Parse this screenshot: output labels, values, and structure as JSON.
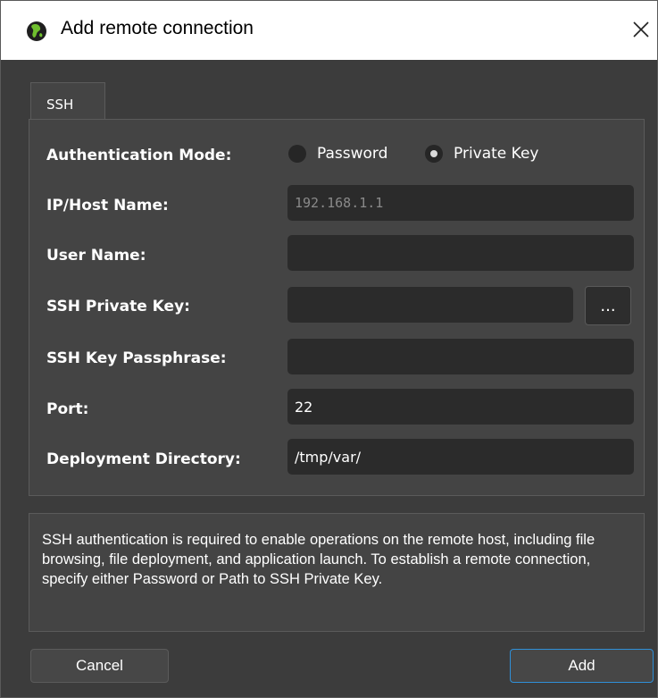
{
  "window": {
    "title": "Add remote connection"
  },
  "tabs": [
    {
      "label": "SSH"
    }
  ],
  "form": {
    "auth_mode_label": "Authentication Mode:",
    "auth_options": [
      {
        "label": "Password",
        "checked": false
      },
      {
        "label": "Private Key",
        "checked": true
      }
    ],
    "host_label": "IP/Host Name:",
    "host_placeholder": "192.168.1.1",
    "host_value": "",
    "user_label": "User Name:",
    "user_value": "",
    "key_label": "SSH Private Key:",
    "key_value": "",
    "browse_label": "...",
    "passphrase_label": "SSH Key Passphrase:",
    "passphrase_value": "",
    "port_label": "Port:",
    "port_value": "22",
    "deploy_label": "Deployment Directory:",
    "deploy_value": "/tmp/var/"
  },
  "info_text": "SSH authentication is required to enable operations on the remote host, including file browsing, file deployment, and application launch. To establish a remote connection, specify either Password or Path to SSH Private Key.",
  "buttons": {
    "cancel": "Cancel",
    "add": "Add"
  },
  "colors": {
    "background": "#3c3c3c",
    "panel": "#444444",
    "field": "#2b2b2b",
    "accent": "#2f8fd8"
  },
  "icons": {
    "app": "green-globe-icon",
    "close": "close-icon"
  }
}
